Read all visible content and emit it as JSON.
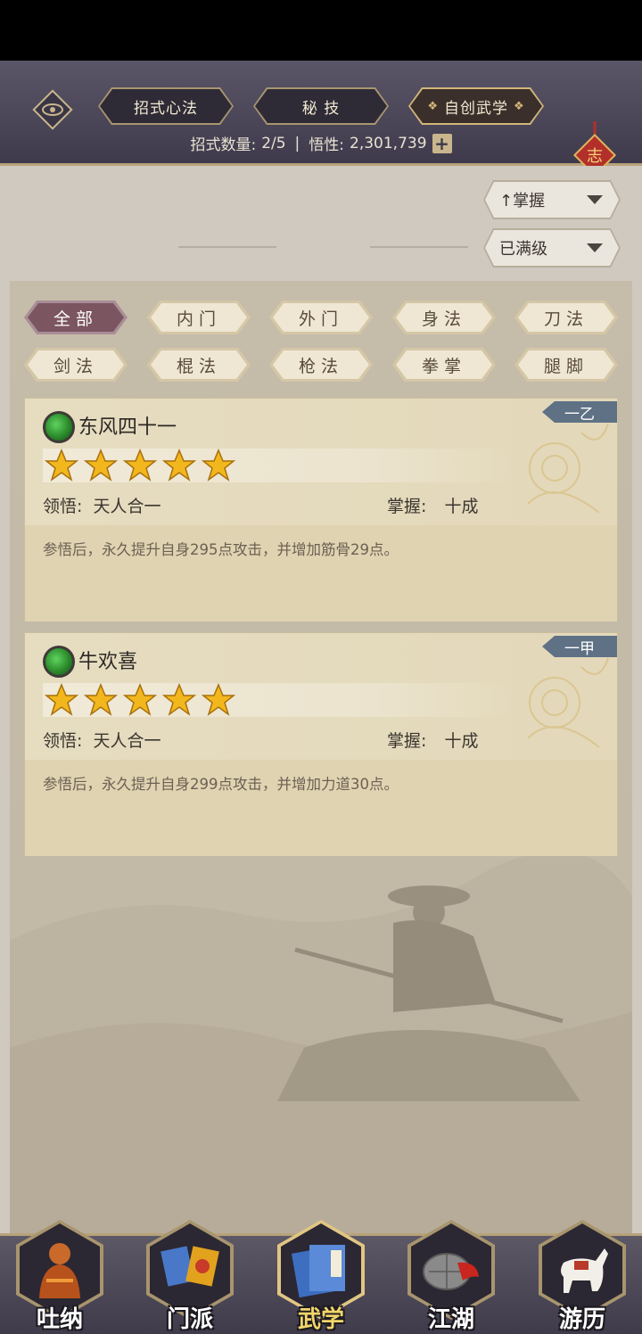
{
  "header": {
    "tabs": [
      {
        "label": "招式心法"
      },
      {
        "label": "秘 技"
      },
      {
        "label": "自创武学"
      }
    ],
    "knot_char": "志",
    "stats": {
      "moves_label": "招式数量:",
      "moves_value": "2/5",
      "separator": "|",
      "insight_label": "悟性:",
      "insight_value": "2,301,739",
      "plus": "+"
    }
  },
  "sort": {
    "dropdown1": "↑掌握",
    "dropdown2": "已满级"
  },
  "filters": [
    {
      "label": "全部",
      "active": true
    },
    {
      "label": "内门"
    },
    {
      "label": "外门"
    },
    {
      "label": "身法"
    },
    {
      "label": "刀法"
    },
    {
      "label": "剑法"
    },
    {
      "label": "棍法"
    },
    {
      "label": "枪法"
    },
    {
      "label": "拳掌"
    },
    {
      "label": "腿脚"
    }
  ],
  "cards": [
    {
      "name": "东风四十一",
      "rank": "一乙",
      "stars": 5,
      "insight_label": "领悟:",
      "insight_value": "天人合一",
      "mastery_label": "掌握:",
      "mastery_value": "十成",
      "description": "参悟后，永久提升自身295点攻击，并增加筋骨29点。"
    },
    {
      "name": "牛欢喜",
      "rank": "一甲",
      "stars": 5,
      "insight_label": "领悟:",
      "insight_value": "天人合一",
      "mastery_label": "掌握:",
      "mastery_value": "十成",
      "description": "参悟后，永久提升自身299点攻击，并增加力道30点。"
    }
  ],
  "bottom_nav": [
    {
      "label": "吐纳",
      "icon": "monk-icon"
    },
    {
      "label": "门派",
      "icon": "banner-icon"
    },
    {
      "label": "武学",
      "icon": "scroll-book-icon",
      "active": true
    },
    {
      "label": "江湖",
      "icon": "bamboo-hat-icon"
    },
    {
      "label": "游历",
      "icon": "horse-icon"
    }
  ],
  "colors": {
    "header_bg": "#4a4658",
    "gold_border": "#b8a279",
    "active_filter": "#7b5560",
    "rank_badge": "#5e7185",
    "card_bg": "#e0d3b1"
  }
}
